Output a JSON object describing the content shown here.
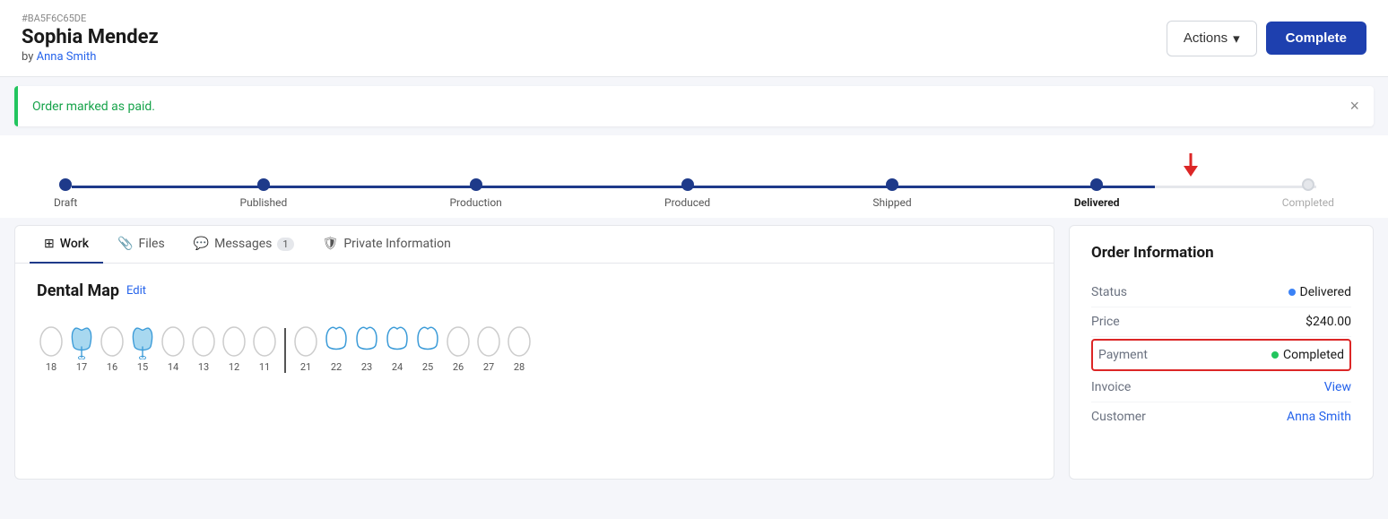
{
  "header": {
    "order_id": "#BA5F6C65DE",
    "order_name": "Sophia Mendez",
    "by_label": "by",
    "assigned_to": "Anna Smith",
    "actions_label": "Actions",
    "complete_label": "Complete"
  },
  "alert": {
    "message": "Order marked as paid.",
    "close_label": "×"
  },
  "progress": {
    "steps": [
      {
        "label": "Draft",
        "active": true,
        "current": false
      },
      {
        "label": "Published",
        "active": true,
        "current": false
      },
      {
        "label": "Production",
        "active": true,
        "current": false
      },
      {
        "label": "Produced",
        "active": true,
        "current": false
      },
      {
        "label": "Shipped",
        "active": true,
        "current": false
      },
      {
        "label": "Delivered",
        "active": true,
        "current": true
      },
      {
        "label": "Completed",
        "active": false,
        "current": false
      }
    ]
  },
  "tabs": [
    {
      "label": "Work",
      "icon": "grid-icon",
      "active": true,
      "badge": null
    },
    {
      "label": "Files",
      "icon": "paperclip-icon",
      "active": false,
      "badge": null
    },
    {
      "label": "Messages",
      "icon": "message-icon",
      "active": false,
      "badge": "1"
    },
    {
      "label": "Private Information",
      "icon": "shield-icon",
      "active": false,
      "badge": null
    }
  ],
  "dental_map": {
    "title": "Dental Map",
    "edit_label": "Edit",
    "teeth": [
      {
        "num": "18",
        "type": "none"
      },
      {
        "num": "17",
        "type": "selected-fill"
      },
      {
        "num": "16",
        "type": "none"
      },
      {
        "num": "15",
        "type": "selected-fill"
      },
      {
        "num": "14",
        "type": "none"
      },
      {
        "num": "13",
        "type": "none"
      },
      {
        "num": "12",
        "type": "none"
      },
      {
        "num": "11",
        "type": "none"
      },
      {
        "num": "21",
        "type": "none"
      },
      {
        "num": "22",
        "type": "selected-stroke"
      },
      {
        "num": "23",
        "type": "selected-stroke"
      },
      {
        "num": "24",
        "type": "selected-stroke"
      },
      {
        "num": "25",
        "type": "selected-stroke"
      },
      {
        "num": "26",
        "type": "none"
      },
      {
        "num": "27",
        "type": "none"
      },
      {
        "num": "28",
        "type": "none"
      }
    ]
  },
  "order_info": {
    "title": "Order Information",
    "rows": [
      {
        "label": "Status",
        "value": "Delivered",
        "type": "status-blue"
      },
      {
        "label": "Price",
        "value": "$240.00",
        "type": "text"
      },
      {
        "label": "Payment",
        "value": "Completed",
        "type": "status-green-highlight"
      },
      {
        "label": "Invoice",
        "value": "View",
        "type": "link"
      },
      {
        "label": "Customer",
        "value": "Anna Smith",
        "type": "link"
      }
    ]
  }
}
